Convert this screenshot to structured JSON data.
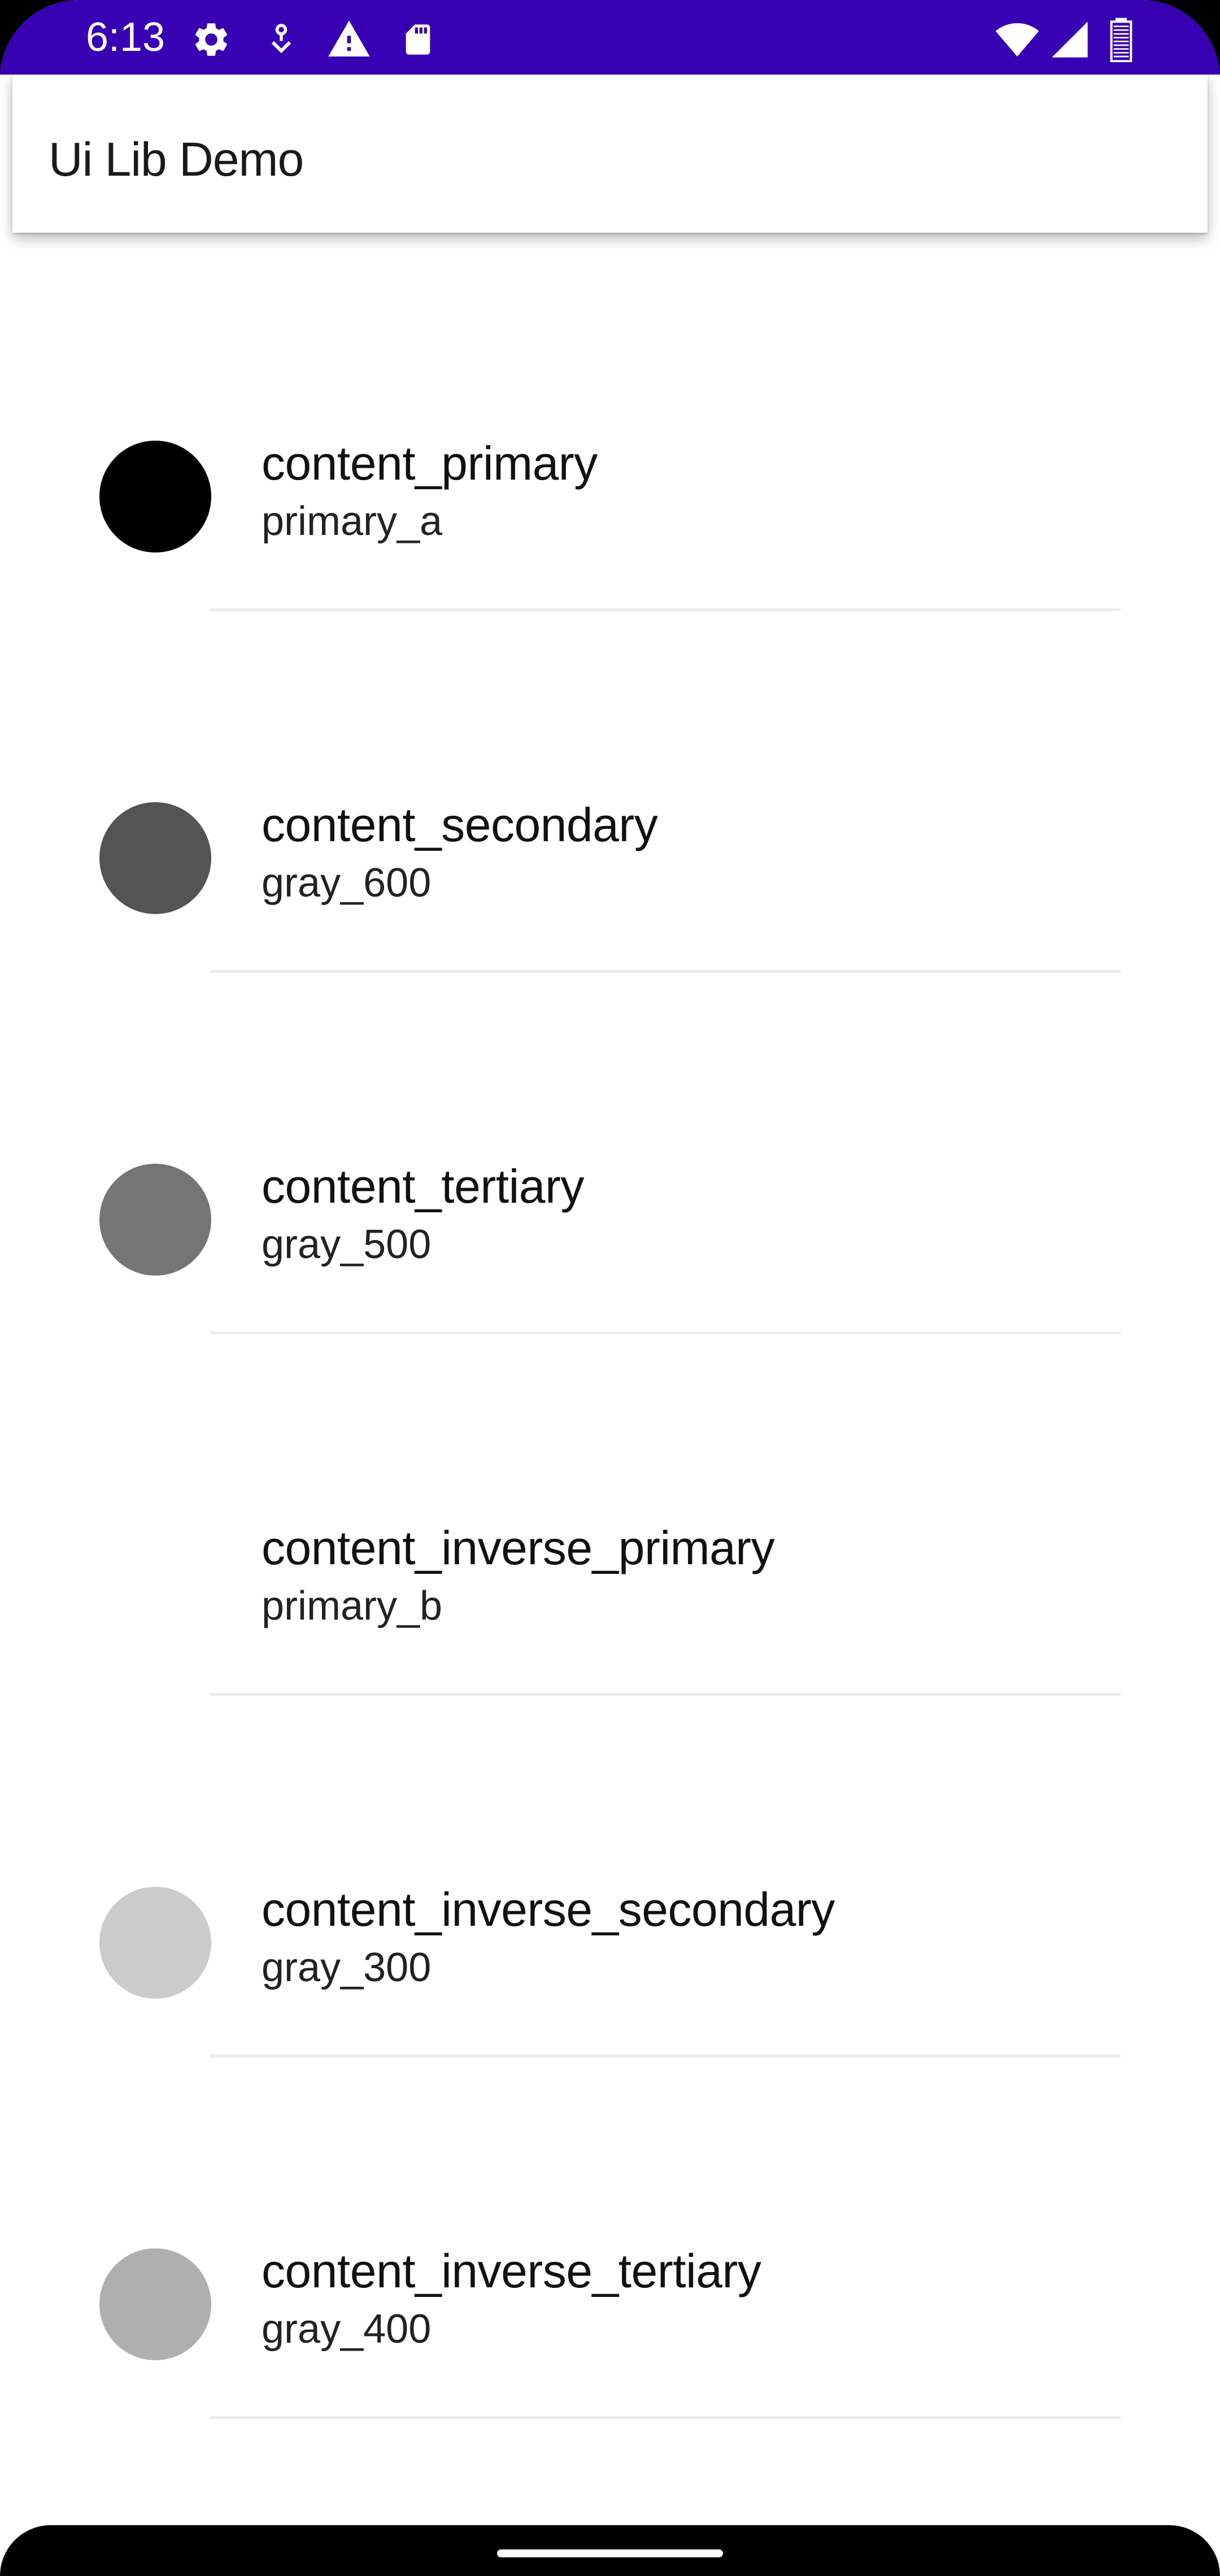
{
  "status_bar": {
    "time": "6:13",
    "left_icons": [
      "gear-icon",
      "download-icon",
      "warning-icon",
      "sd-card-icon"
    ],
    "right_icons": [
      "wifi-icon",
      "signal-icon",
      "battery-icon"
    ],
    "background": "#3700b3"
  },
  "app_bar": {
    "title": "Ui Lib Demo"
  },
  "list": {
    "items": [
      {
        "title": "content_primary",
        "subtitle": "primary_a",
        "color": "#000000"
      },
      {
        "title": "content_secondary",
        "subtitle": "gray_600",
        "color": "#545454"
      },
      {
        "title": "content_tertiary",
        "subtitle": "gray_500",
        "color": "#757575"
      },
      {
        "title": "content_inverse_primary",
        "subtitle": "primary_b",
        "color": "#ffffff"
      },
      {
        "title": "content_inverse_secondary",
        "subtitle": "gray_300",
        "color": "#cbcbcb"
      },
      {
        "title": "content_inverse_tertiary",
        "subtitle": "gray_400",
        "color": "#afafaf"
      }
    ]
  }
}
